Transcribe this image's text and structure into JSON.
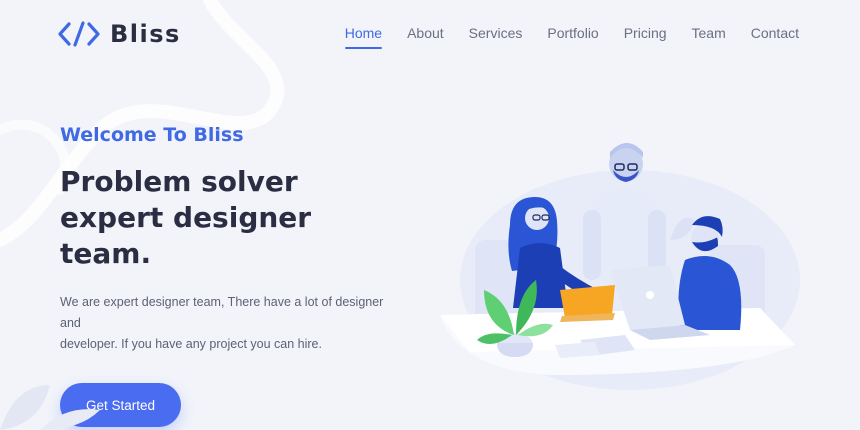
{
  "brand": {
    "name": "Bliss",
    "logo_icon": "code-brackets-icon",
    "accent_color": "#3f6ae4"
  },
  "nav": {
    "items": [
      {
        "label": "Home",
        "active": true
      },
      {
        "label": "About"
      },
      {
        "label": "Services"
      },
      {
        "label": "Portfolio"
      },
      {
        "label": "Pricing"
      },
      {
        "label": "Team"
      },
      {
        "label": "Contact"
      }
    ]
  },
  "hero": {
    "eyebrow": "Welcome To Bliss",
    "headline_line1": "Problem solver",
    "headline_line2": "expert designer",
    "headline_line3": "team.",
    "description_line1": "We are expert designer team, There have a lot of designer and",
    "description_line2": "developer. If you have any project you can hire.",
    "cta_label": "Get Started",
    "cta_color": "#4a6cf0",
    "heading_color": "#2b2d42",
    "illustration": "team-meeting-illustration"
  }
}
